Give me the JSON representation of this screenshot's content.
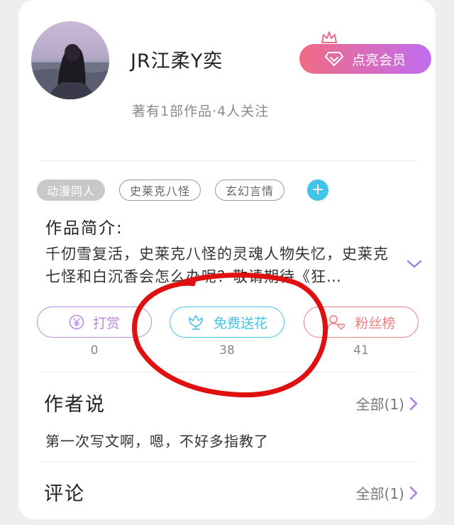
{
  "author": {
    "name": "JR江柔Y奕",
    "stats": "著有1部作品·4人关注",
    "vip_label": "点亮会员"
  },
  "tags": [
    "动漫同人",
    "史莱克八怪",
    "玄幻言情"
  ],
  "add_tag_symbol": "+",
  "intro": {
    "title": "作品简介:",
    "text": "千仞雪复活，史莱克八怪的灵魂人物失忆，史莱克七怪和白沉香会怎么办呢？敬请期待《狂…"
  },
  "actions": [
    {
      "label": "打赏",
      "count": "0",
      "color": "#b98be0"
    },
    {
      "label": "免费送花",
      "count": "38",
      "color": "#45c2e6"
    },
    {
      "label": "粉丝榜",
      "count": "41",
      "color": "#ef7d82"
    }
  ],
  "author_note": {
    "title": "作者说",
    "more": "全部(1)",
    "text": "第一次写文啊，嗯，不好多指教了"
  },
  "comments": {
    "title": "评论",
    "more": "全部(1)"
  },
  "colors": {
    "vip_gradient_start": "#f06b85",
    "vip_gradient_end": "#c16cf0",
    "accent_purple": "#a77ce0",
    "annotation_red": "#e01010"
  },
  "icons": [
    "crown-icon",
    "diamond-icon",
    "yen-coin-icon",
    "flower-icon",
    "fan-user-icon",
    "chevron-down-icon",
    "chevron-right-icon"
  ]
}
